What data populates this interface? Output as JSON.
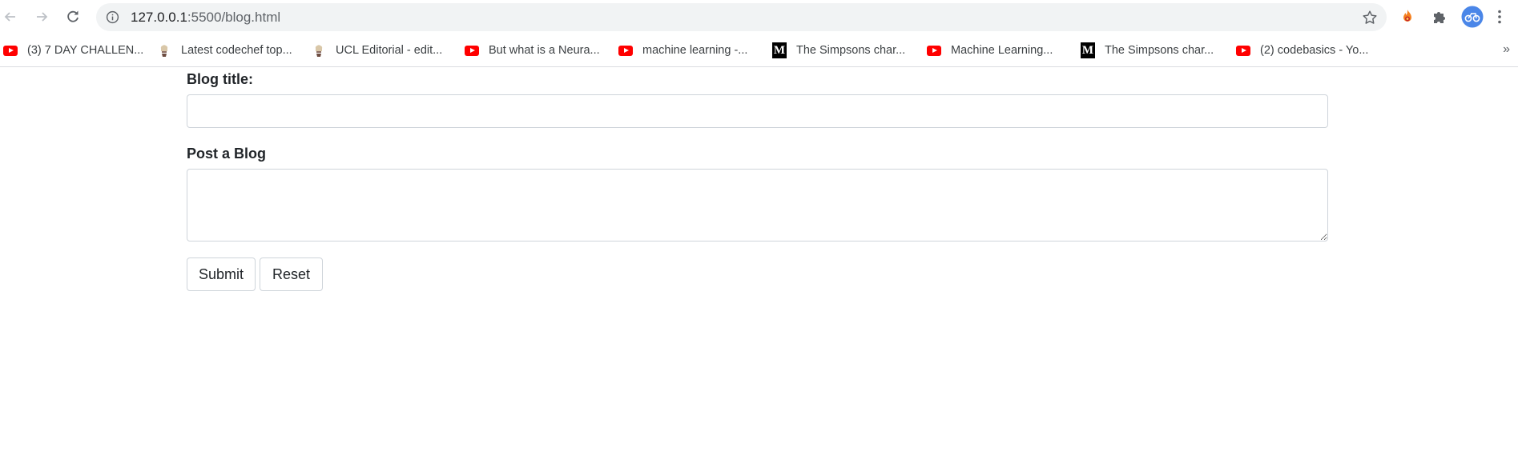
{
  "browser": {
    "url_host": "127.0.0.1",
    "url_path": ":5500/blog.html",
    "toolbar_icons": [
      "back-arrow-icon",
      "forward-arrow-icon",
      "reload-icon",
      "info-icon",
      "star-icon",
      "fire-extension-icon",
      "puzzle-extensions-icon",
      "profile-avatar-icon",
      "kebab-menu-icon"
    ]
  },
  "bookmarks": [
    {
      "label": "(3) 7 DAY CHALLEN...",
      "icon": "youtube-icon"
    },
    {
      "label": "Latest codechef top...",
      "icon": "codechef-icon"
    },
    {
      "label": "UCL Editorial - edit...",
      "icon": "codechef-icon"
    },
    {
      "label": "But what is a Neura...",
      "icon": "youtube-icon"
    },
    {
      "label": "machine learning -...",
      "icon": "youtube-icon"
    },
    {
      "label": "The Simpsons char...",
      "icon": "medium-icon"
    },
    {
      "label": "Machine Learning...",
      "icon": "youtube-icon"
    },
    {
      "label": "The Simpsons char...",
      "icon": "medium-icon"
    },
    {
      "label": "(2) codebasics - Yo...",
      "icon": "youtube-icon"
    }
  ],
  "bookmarks_overflow": "»",
  "form": {
    "title_label": "Blog title:",
    "title_value": "",
    "body_label": "Post a Blog",
    "body_value": "",
    "submit_label": "Submit",
    "reset_label": "Reset"
  }
}
